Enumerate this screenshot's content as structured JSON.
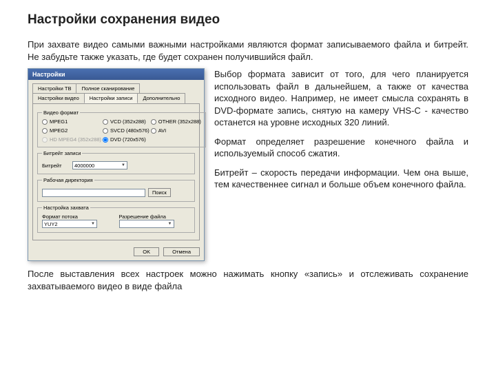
{
  "title": "Настройки сохранения видео",
  "intro": "При захвате видео самыми важными настройками являются формат записываемого файла и битрейт. Не забудьте также указать, где будет сохранен получившийся файл.",
  "dialog": {
    "title": "Настройки",
    "tabs_row1": [
      "Настройки ТВ",
      "Полное сканирование"
    ],
    "tabs_row2": [
      "Настройки видео",
      "Настройки записи",
      "Дополнительно"
    ],
    "active_tab": "Настройки записи",
    "group_video_format": "Видео формат",
    "radios": [
      {
        "label": "MPEG1",
        "checked": false
      },
      {
        "label": "VCD (352x288)",
        "checked": false
      },
      {
        "label": "OTHER (352x288)",
        "checked": false
      },
      {
        "label": "MPEG2",
        "checked": false
      },
      {
        "label": "SVCD (480x576)",
        "checked": false
      },
      {
        "label": "AVI",
        "checked": false
      },
      {
        "label": "HD MPEG4 (352x288)",
        "checked": false,
        "disabled": true
      },
      {
        "label": "DVD (720x576)",
        "checked": true
      }
    ],
    "group_bitrate": "Битрейт записи",
    "bitrate_label": "Битрейт",
    "bitrate_value": "4000000",
    "group_dir": "Рабочая директория",
    "dir_value": "",
    "browse_btn": "Поиск",
    "group_capture": "Настройка захвата",
    "stream_label": "Формат потока",
    "stream_value": "YUY2",
    "res_label": "Разрешение файла",
    "res_value": "",
    "ok_btn": "OK",
    "cancel_btn": "Отмена"
  },
  "right": [
    "Выбор формата зависит от того, для чего планируется использовать файл в дальнейшем, а также от качества исходного видео. Например, не имеет смысла сохранять в DVD-формате запись, снятую на камеру VHS-C - качество останется на уровне исходных 320 линий.",
    "Формат определяет разрешение конечного файла и используемый способ сжатия.",
    "Битрейт – скорость передачи информации. Чем она выше, тем качественнее сигнал и больше объем конечного файла."
  ],
  "outro": "После выставления всех настроек можно нажимать кнопку «запись» и отслеживать сохранение захватываемого видео в виде файла"
}
